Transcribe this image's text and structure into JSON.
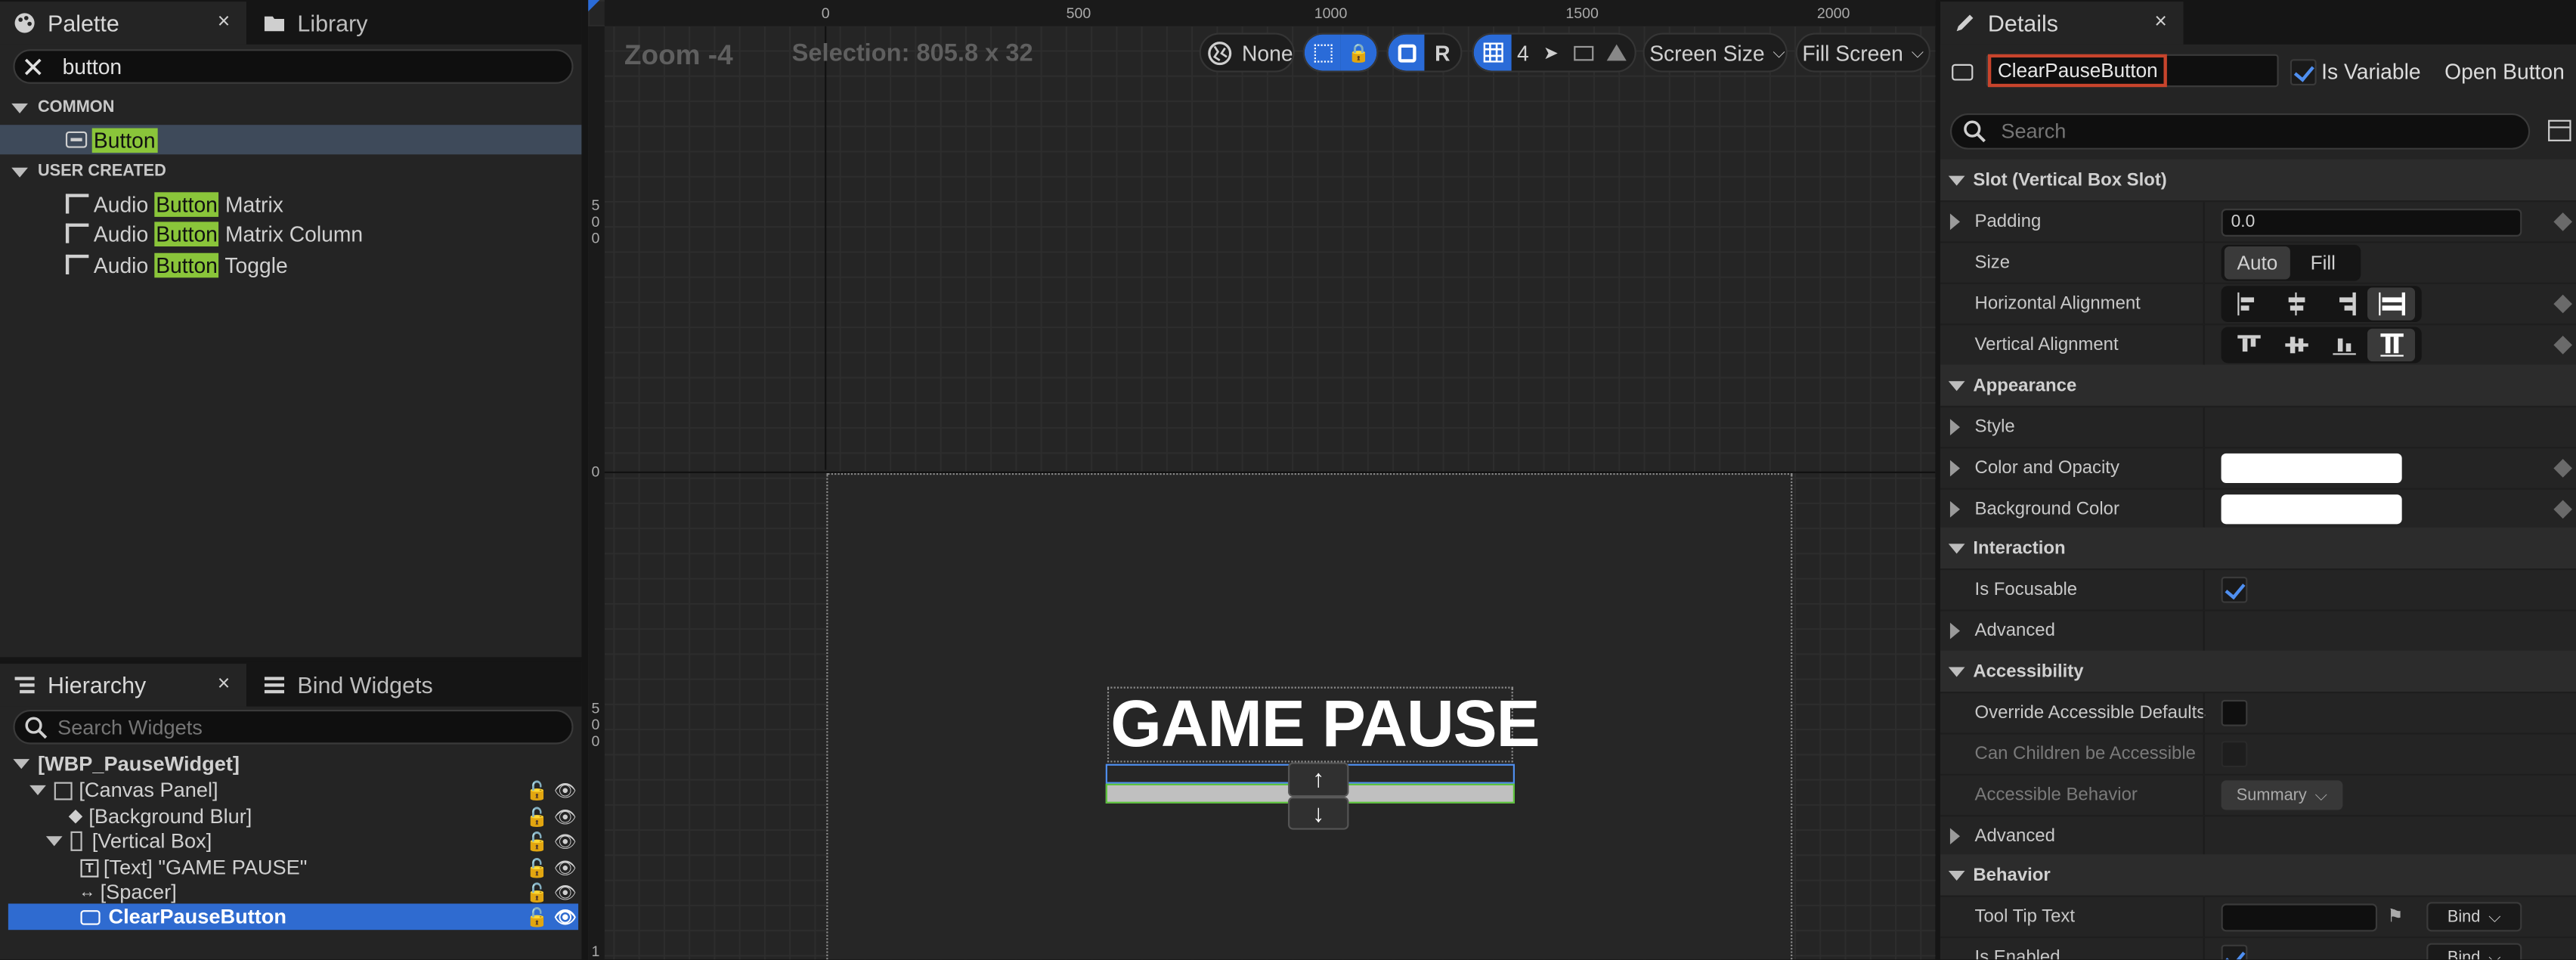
{
  "palette": {
    "tab_label": "Palette",
    "library_tab_label": "Library",
    "close_glyph": "×",
    "search_value": "button",
    "categories": {
      "common": {
        "label": "COMMON",
        "items": [
          {
            "pre": "",
            "hl": "Button",
            "post": ""
          }
        ]
      },
      "user_created": {
        "label": "USER CREATED",
        "items": [
          {
            "pre": "Audio ",
            "hl": "Button",
            "post": " Matrix"
          },
          {
            "pre": "Audio ",
            "hl": "Button",
            "post": " Matrix Column"
          },
          {
            "pre": "Audio ",
            "hl": "Button",
            "post": " Toggle"
          }
        ]
      }
    }
  },
  "hierarchy": {
    "tab_label": "Hierarchy",
    "bind_tab_label": "Bind Widgets",
    "close_glyph": "×",
    "search_placeholder": "Search Widgets",
    "rows": [
      {
        "label": "[WBP_PauseWidget]"
      },
      {
        "label": "[Canvas Panel]"
      },
      {
        "label": "[Background Blur]"
      },
      {
        "label": "[Vertical Box]"
      },
      {
        "label": "[Text] \"GAME PAUSE\""
      },
      {
        "label": "[Spacer]"
      },
      {
        "label": "ClearPauseButton"
      }
    ]
  },
  "canvas": {
    "zoom_label": "Zoom -4",
    "selection_label": "Selection: 805.8 x 32",
    "ruler_top": [
      "0",
      "500",
      "1000",
      "1500",
      "2000"
    ],
    "ruler_left": [
      "5\n0\n0",
      "0",
      "5\n0\n0",
      "1"
    ],
    "toolbar": {
      "none_label": "None",
      "r_label": "R",
      "grid_count": "4",
      "screen_size_label": "Screen Size",
      "fill_screen_label": "Fill Screen"
    },
    "title_text": "GAME PAUSE",
    "arrow_up": "↑",
    "arrow_down": "↓"
  },
  "details": {
    "tab_label": "Details",
    "close_glyph": "×",
    "widget_name": "ClearPauseButton",
    "is_variable_label": "Is Variable",
    "open_button_label": "Open Button",
    "search_placeholder": "Search",
    "sections": {
      "slot": "Slot (Vertical Box Slot)",
      "appearance": "Appearance",
      "interaction": "Interaction",
      "accessibility": "Accessibility",
      "behavior": "Behavior"
    },
    "rows": {
      "padding": {
        "label": "Padding",
        "value": "0.0"
      },
      "size": {
        "label": "Size",
        "auto": "Auto",
        "fill": "Fill"
      },
      "h_align": {
        "label": "Horizontal Alignment"
      },
      "v_align": {
        "label": "Vertical Alignment"
      },
      "style": {
        "label": "Style"
      },
      "color_opacity": {
        "label": "Color and Opacity"
      },
      "background_color": {
        "label": "Background Color"
      },
      "is_focusable": {
        "label": "Is Focusable"
      },
      "advanced_1": {
        "label": "Advanced"
      },
      "override_defaults": {
        "label": "Override Accessible Defaults"
      },
      "can_children": {
        "label": "Can Children be Accessible"
      },
      "accessible_behavior": {
        "label": "Accessible Behavior",
        "value": "Summary"
      },
      "advanced_2": {
        "label": "Advanced"
      },
      "tool_tip": {
        "label": "Tool Tip Text",
        "bind": "Bind"
      },
      "is_enabled": {
        "label": "Is Enabled",
        "bind": "Bind"
      }
    }
  },
  "colors": {
    "accent_blue": "#2f6bd0",
    "highlight_green": "#8ac53a",
    "name_border": "#c8442c"
  }
}
